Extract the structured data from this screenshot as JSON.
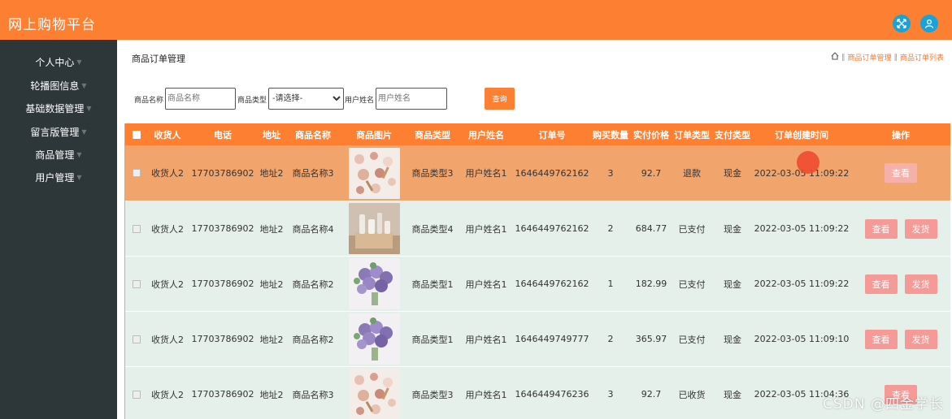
{
  "header": {
    "brand": "网上购物平台",
    "icons": [
      "fullscreen-icon",
      "user-icon"
    ]
  },
  "sidebar": {
    "items": [
      {
        "label": "个人中心"
      },
      {
        "label": "轮播图信息"
      },
      {
        "label": "基础数据管理"
      },
      {
        "label": "留言版管理"
      },
      {
        "label": "商品管理"
      },
      {
        "label": "用户管理"
      }
    ]
  },
  "page": {
    "title": "商品订单管理",
    "breadcrumb": [
      "商品订单管理",
      "商品订单列表"
    ]
  },
  "search": {
    "name_label": "商品名称",
    "name_placeholder": "商品名称",
    "type_label": "商品类型",
    "type_selected": "-请选择-",
    "user_label": "用户姓名",
    "user_placeholder": "用户姓名",
    "button": "查询"
  },
  "table": {
    "headers": [
      "收货人",
      "电话",
      "地址",
      "商品名称",
      "商品图片",
      "商品类型",
      "用户姓名",
      "订单号",
      "购买数量",
      "实付价格",
      "订单类型",
      "支付类型",
      "订单创建时间",
      "操作"
    ],
    "rows": [
      {
        "receiver": "收货人2",
        "phone": "17703786902",
        "address": "地址2",
        "product": "商品名称3",
        "image": "cosmetics",
        "ptype": "商品类型3",
        "user": "用户姓名1",
        "order_no": "1646449762162",
        "qty": "3",
        "price": "92.7",
        "status": "退款",
        "pay": "现金",
        "created": "2022-03-05 11:09:22",
        "actions": [
          "查看"
        ]
      },
      {
        "receiver": "收货人2",
        "phone": "17703786902",
        "address": "地址2",
        "product": "商品名称4",
        "image": "skincare",
        "ptype": "商品类型4",
        "user": "用户姓名1",
        "order_no": "1646449762162",
        "qty": "2",
        "price": "684.77",
        "status": "已支付",
        "pay": "现金",
        "created": "2022-03-05 11:09:22",
        "actions": [
          "查看",
          "发货"
        ]
      },
      {
        "receiver": "收货人2",
        "phone": "17703786902",
        "address": "地址2",
        "product": "商品名称2",
        "image": "flowers",
        "ptype": "商品类型1",
        "user": "用户姓名1",
        "order_no": "1646449762162",
        "qty": "1",
        "price": "182.99",
        "status": "已支付",
        "pay": "现金",
        "created": "2022-03-05 11:09:22",
        "actions": [
          "查看",
          "发货"
        ]
      },
      {
        "receiver": "收货人2",
        "phone": "17703786902",
        "address": "地址2",
        "product": "商品名称2",
        "image": "flowers",
        "ptype": "商品类型1",
        "user": "用户姓名1",
        "order_no": "1646449749777",
        "qty": "2",
        "price": "365.97",
        "status": "已支付",
        "pay": "现金",
        "created": "2022-03-05 11:09:10",
        "actions": [
          "查看",
          "发货"
        ]
      },
      {
        "receiver": "收货人2",
        "phone": "17703786902",
        "address": "地址2",
        "product": "商品名称3",
        "image": "cosmetics",
        "ptype": "商品类型3",
        "user": "用户姓名1",
        "order_no": "1646449476236",
        "qty": "3",
        "price": "92.7",
        "status": "已收货",
        "pay": "现金",
        "created": "2022-03-05 11:04:36",
        "actions": [
          "查看"
        ]
      }
    ]
  },
  "watermark": "CSDN @四金学长",
  "colors": {
    "primary": "#fd8032",
    "sidebar": "#2d3639",
    "selected_row": "#f2a46d",
    "row_bg": "#e5f0ea",
    "action_button": "#f59a96"
  }
}
